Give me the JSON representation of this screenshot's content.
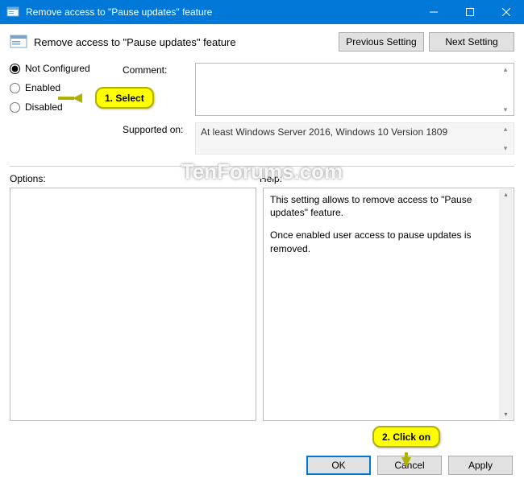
{
  "titlebar": {
    "title": "Remove access to \"Pause updates\" feature"
  },
  "header": {
    "title": "Remove access to \"Pause updates\" feature",
    "prev_label": "Previous Setting",
    "next_label": "Next Setting"
  },
  "radios": {
    "not_configured": "Not Configured",
    "enabled": "Enabled",
    "disabled": "Disabled"
  },
  "fields": {
    "comment_label": "Comment:",
    "supported_label": "Supported on:",
    "supported_text": "At least Windows Server 2016, Windows 10 Version 1809"
  },
  "panels": {
    "options_label": "Options:",
    "help_label": "Help:",
    "help_line1": "This setting allows to remove access to \"Pause updates\" feature.",
    "help_line2": "Once enabled user access to pause updates is removed."
  },
  "footer": {
    "ok": "OK",
    "cancel": "Cancel",
    "apply": "Apply"
  },
  "callouts": {
    "select": "1. Select",
    "click": "2. Click on"
  },
  "watermark": "TenForums.com"
}
